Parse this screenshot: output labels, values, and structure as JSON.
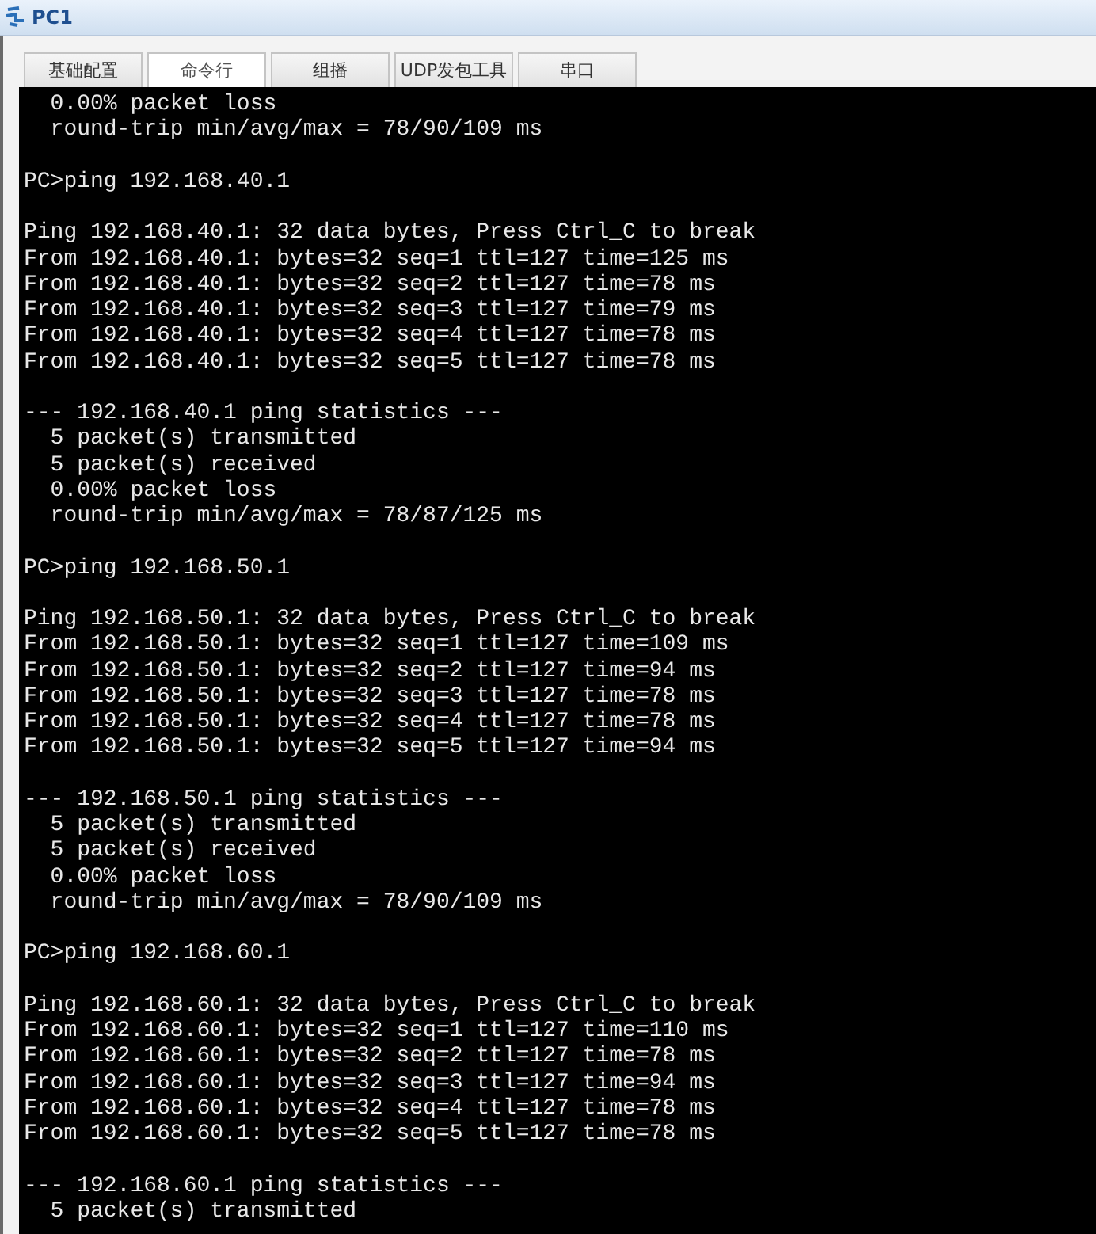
{
  "window": {
    "title": "PC1"
  },
  "tabs": [
    {
      "label": "基础配置",
      "selected": false
    },
    {
      "label": "命令行",
      "selected": true
    },
    {
      "label": "组播",
      "selected": false
    },
    {
      "label": "UDP发包工具",
      "selected": false
    },
    {
      "label": "串口",
      "selected": false
    }
  ],
  "terminal": {
    "blocks": [
      [
        "  0.00% packet loss",
        "  round-trip min/avg/max = 78/90/109 ms"
      ],
      [
        "PC>ping 192.168.40.1"
      ],
      [
        "Ping 192.168.40.1: 32 data bytes, Press Ctrl_C to break",
        "From 192.168.40.1: bytes=32 seq=1 ttl=127 time=125 ms",
        "From 192.168.40.1: bytes=32 seq=2 ttl=127 time=78 ms",
        "From 192.168.40.1: bytes=32 seq=3 ttl=127 time=79 ms",
        "From 192.168.40.1: bytes=32 seq=4 ttl=127 time=78 ms",
        "From 192.168.40.1: bytes=32 seq=5 ttl=127 time=78 ms"
      ],
      [
        "--- 192.168.40.1 ping statistics ---",
        "  5 packet(s) transmitted",
        "  5 packet(s) received",
        "  0.00% packet loss",
        "  round-trip min/avg/max = 78/87/125 ms"
      ],
      [
        "PC>ping 192.168.50.1"
      ],
      [
        "Ping 192.168.50.1: 32 data bytes, Press Ctrl_C to break",
        "From 192.168.50.1: bytes=32 seq=1 ttl=127 time=109 ms",
        "From 192.168.50.1: bytes=32 seq=2 ttl=127 time=94 ms",
        "From 192.168.50.1: bytes=32 seq=3 ttl=127 time=78 ms",
        "From 192.168.50.1: bytes=32 seq=4 ttl=127 time=78 ms",
        "From 192.168.50.1: bytes=32 seq=5 ttl=127 time=94 ms"
      ],
      [
        "--- 192.168.50.1 ping statistics ---",
        "  5 packet(s) transmitted",
        "  5 packet(s) received",
        "  0.00% packet loss",
        "  round-trip min/avg/max = 78/90/109 ms"
      ],
      [
        "PC>ping 192.168.60.1"
      ],
      [
        "Ping 192.168.60.1: 32 data bytes, Press Ctrl_C to break",
        "From 192.168.60.1: bytes=32 seq=1 ttl=127 time=110 ms",
        "From 192.168.60.1: bytes=32 seq=2 ttl=127 time=78 ms",
        "From 192.168.60.1: bytes=32 seq=3 ttl=127 time=94 ms",
        "From 192.168.60.1: bytes=32 seq=4 ttl=127 time=78 ms",
        "From 192.168.60.1: bytes=32 seq=5 ttl=127 time=78 ms"
      ],
      [
        "--- 192.168.60.1 ping statistics ---",
        "  5 packet(s) transmitted"
      ]
    ]
  }
}
